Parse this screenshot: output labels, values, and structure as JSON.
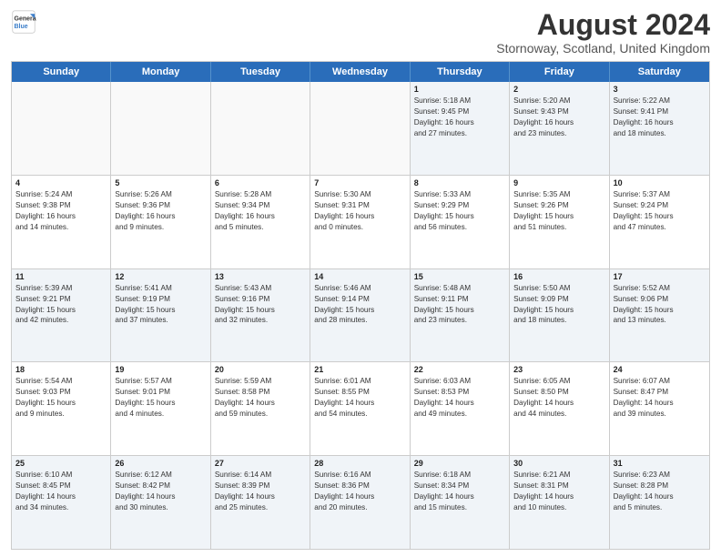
{
  "header": {
    "logo_line1": "General",
    "logo_line2": "Blue",
    "main_title": "August 2024",
    "subtitle": "Stornoway, Scotland, United Kingdom"
  },
  "days_of_week": [
    "Sunday",
    "Monday",
    "Tuesday",
    "Wednesday",
    "Thursday",
    "Friday",
    "Saturday"
  ],
  "weeks": [
    {
      "row": 0,
      "cells": [
        {
          "day": "",
          "content": ""
        },
        {
          "day": "",
          "content": ""
        },
        {
          "day": "",
          "content": ""
        },
        {
          "day": "",
          "content": ""
        },
        {
          "day": "1",
          "content": "Sunrise: 5:18 AM\nSunset: 9:45 PM\nDaylight: 16 hours\nand 27 minutes."
        },
        {
          "day": "2",
          "content": "Sunrise: 5:20 AM\nSunset: 9:43 PM\nDaylight: 16 hours\nand 23 minutes."
        },
        {
          "day": "3",
          "content": "Sunrise: 5:22 AM\nSunset: 9:41 PM\nDaylight: 16 hours\nand 18 minutes."
        }
      ]
    },
    {
      "row": 1,
      "cells": [
        {
          "day": "4",
          "content": "Sunrise: 5:24 AM\nSunset: 9:38 PM\nDaylight: 16 hours\nand 14 minutes."
        },
        {
          "day": "5",
          "content": "Sunrise: 5:26 AM\nSunset: 9:36 PM\nDaylight: 16 hours\nand 9 minutes."
        },
        {
          "day": "6",
          "content": "Sunrise: 5:28 AM\nSunset: 9:34 PM\nDaylight: 16 hours\nand 5 minutes."
        },
        {
          "day": "7",
          "content": "Sunrise: 5:30 AM\nSunset: 9:31 PM\nDaylight: 16 hours\nand 0 minutes."
        },
        {
          "day": "8",
          "content": "Sunrise: 5:33 AM\nSunset: 9:29 PM\nDaylight: 15 hours\nand 56 minutes."
        },
        {
          "day": "9",
          "content": "Sunrise: 5:35 AM\nSunset: 9:26 PM\nDaylight: 15 hours\nand 51 minutes."
        },
        {
          "day": "10",
          "content": "Sunrise: 5:37 AM\nSunset: 9:24 PM\nDaylight: 15 hours\nand 47 minutes."
        }
      ]
    },
    {
      "row": 2,
      "cells": [
        {
          "day": "11",
          "content": "Sunrise: 5:39 AM\nSunset: 9:21 PM\nDaylight: 15 hours\nand 42 minutes."
        },
        {
          "day": "12",
          "content": "Sunrise: 5:41 AM\nSunset: 9:19 PM\nDaylight: 15 hours\nand 37 minutes."
        },
        {
          "day": "13",
          "content": "Sunrise: 5:43 AM\nSunset: 9:16 PM\nDaylight: 15 hours\nand 32 minutes."
        },
        {
          "day": "14",
          "content": "Sunrise: 5:46 AM\nSunset: 9:14 PM\nDaylight: 15 hours\nand 28 minutes."
        },
        {
          "day": "15",
          "content": "Sunrise: 5:48 AM\nSunset: 9:11 PM\nDaylight: 15 hours\nand 23 minutes."
        },
        {
          "day": "16",
          "content": "Sunrise: 5:50 AM\nSunset: 9:09 PM\nDaylight: 15 hours\nand 18 minutes."
        },
        {
          "day": "17",
          "content": "Sunrise: 5:52 AM\nSunset: 9:06 PM\nDaylight: 15 hours\nand 13 minutes."
        }
      ]
    },
    {
      "row": 3,
      "cells": [
        {
          "day": "18",
          "content": "Sunrise: 5:54 AM\nSunset: 9:03 PM\nDaylight: 15 hours\nand 9 minutes."
        },
        {
          "day": "19",
          "content": "Sunrise: 5:57 AM\nSunset: 9:01 PM\nDaylight: 15 hours\nand 4 minutes."
        },
        {
          "day": "20",
          "content": "Sunrise: 5:59 AM\nSunset: 8:58 PM\nDaylight: 14 hours\nand 59 minutes."
        },
        {
          "day": "21",
          "content": "Sunrise: 6:01 AM\nSunset: 8:55 PM\nDaylight: 14 hours\nand 54 minutes."
        },
        {
          "day": "22",
          "content": "Sunrise: 6:03 AM\nSunset: 8:53 PM\nDaylight: 14 hours\nand 49 minutes."
        },
        {
          "day": "23",
          "content": "Sunrise: 6:05 AM\nSunset: 8:50 PM\nDaylight: 14 hours\nand 44 minutes."
        },
        {
          "day": "24",
          "content": "Sunrise: 6:07 AM\nSunset: 8:47 PM\nDaylight: 14 hours\nand 39 minutes."
        }
      ]
    },
    {
      "row": 4,
      "cells": [
        {
          "day": "25",
          "content": "Sunrise: 6:10 AM\nSunset: 8:45 PM\nDaylight: 14 hours\nand 34 minutes."
        },
        {
          "day": "26",
          "content": "Sunrise: 6:12 AM\nSunset: 8:42 PM\nDaylight: 14 hours\nand 30 minutes."
        },
        {
          "day": "27",
          "content": "Sunrise: 6:14 AM\nSunset: 8:39 PM\nDaylight: 14 hours\nand 25 minutes."
        },
        {
          "day": "28",
          "content": "Sunrise: 6:16 AM\nSunset: 8:36 PM\nDaylight: 14 hours\nand 20 minutes."
        },
        {
          "day": "29",
          "content": "Sunrise: 6:18 AM\nSunset: 8:34 PM\nDaylight: 14 hours\nand 15 minutes."
        },
        {
          "day": "30",
          "content": "Sunrise: 6:21 AM\nSunset: 8:31 PM\nDaylight: 14 hours\nand 10 minutes."
        },
        {
          "day": "31",
          "content": "Sunrise: 6:23 AM\nSunset: 8:28 PM\nDaylight: 14 hours\nand 5 minutes."
        }
      ]
    }
  ]
}
